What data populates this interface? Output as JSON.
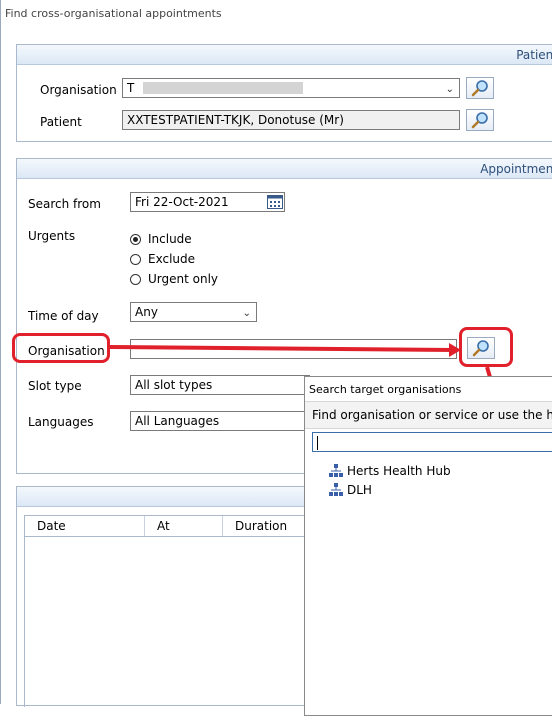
{
  "window": {
    "title": "Find cross-organisational appointments"
  },
  "patient_section": {
    "header": "Patient",
    "organisation_label": "Organisation",
    "organisation_value": "T",
    "patient_label": "Patient",
    "patient_value": "XXTESTPATIENT-TKJK, Donotuse (Mr)"
  },
  "appointment_section": {
    "header": "Appointment",
    "search_from_label": "Search from",
    "search_from_value": "Fri 22-Oct-2021",
    "urgents_label": "Urgents",
    "urgents_options": [
      "Include",
      "Exclude",
      "Urgent only"
    ],
    "urgents_selected": "Include",
    "time_of_day_label": "Time of day",
    "time_of_day_value": "Any",
    "organisation_label": "Organisation",
    "organisation_value": "",
    "slot_type_label": "Slot type",
    "slot_type_value": "All slot types",
    "languages_label": "Languages",
    "languages_value": "All Languages"
  },
  "results_grid": {
    "columns": [
      "Date",
      "At",
      "Duration"
    ]
  },
  "popup": {
    "title": "Search target organisations",
    "instruction": "Find organisation or service or use the hier",
    "search_value": "",
    "tree_items": [
      "Herts Health Hub",
      "DLH"
    ]
  },
  "colors": {
    "annotation_red": "#e0202a",
    "header_text": "#2e4f79",
    "header_bg": "#dce8f6"
  },
  "icons": [
    "magnifier-icon",
    "calendar-icon",
    "org-tree-icon",
    "chevron-down-icon"
  ]
}
